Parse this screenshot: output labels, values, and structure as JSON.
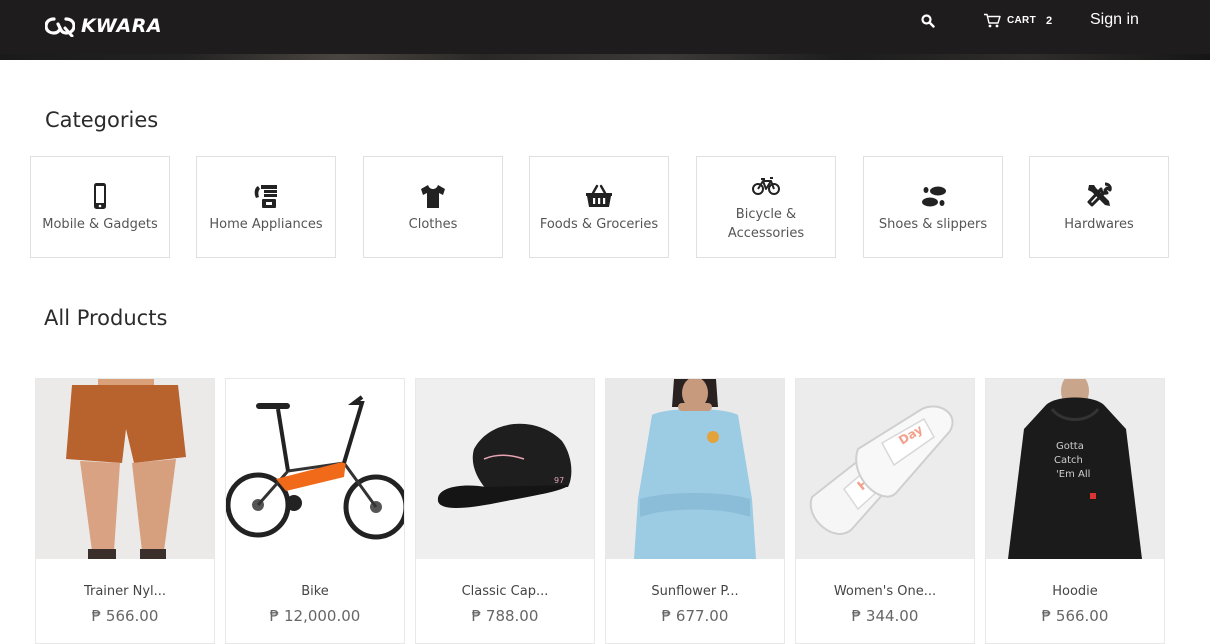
{
  "header": {
    "brand_name": "KWARA",
    "cart_label": "CART",
    "cart_count": "2",
    "signin_label": "Sign in",
    "background": "#1e1c1c"
  },
  "categories": {
    "title": "Categories",
    "items": [
      {
        "label": "Mobile & Gadgets",
        "icon": "mobile-phone-icon"
      },
      {
        "label": "Home Appliances",
        "icon": "appliance-icon"
      },
      {
        "label": "Clothes",
        "icon": "tshirt-icon"
      },
      {
        "label": "Foods & Groceries",
        "icon": "basket-icon"
      },
      {
        "label": "Bicycle & Accessories",
        "icon": "bicycle-icon"
      },
      {
        "label": "Shoes & slippers",
        "icon": "footprints-icon"
      },
      {
        "label": "Hardwares",
        "icon": "tools-icon"
      }
    ]
  },
  "products": {
    "title": "All Products",
    "items": [
      {
        "name": "Trainer Nyl...",
        "price": "₱ 566.00",
        "image": "orange shorts"
      },
      {
        "name": "Bike",
        "price": "₱ 12,000.00",
        "image": "orange folding bike"
      },
      {
        "name": "Classic Cap...",
        "price": "₱ 788.00",
        "image": "black cap"
      },
      {
        "name": "Sunflower P...",
        "price": "₱ 677.00",
        "image": "light blue sweatshirt"
      },
      {
        "name": "Women's One...",
        "price": "₱ 344.00",
        "image": "white slides"
      },
      {
        "name": "Hoodie",
        "price": "₱ 566.00",
        "image": "black hoodie"
      }
    ]
  }
}
